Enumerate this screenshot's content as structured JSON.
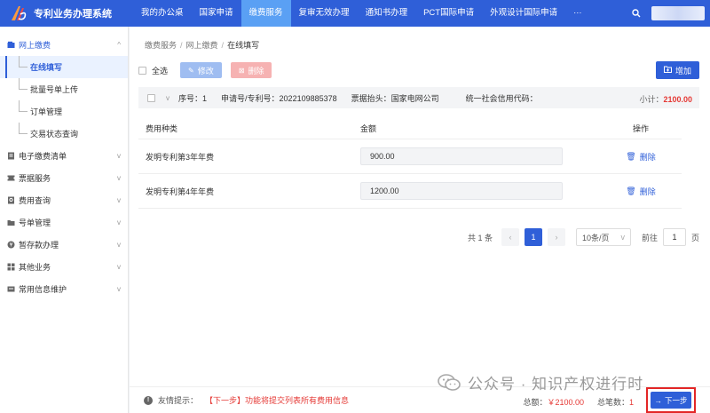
{
  "app": {
    "title": "专利业务办理系统"
  },
  "nav": {
    "items": [
      "我的办公桌",
      "国家申请",
      "缴费服务",
      "复审无效办理",
      "通知书办理",
      "PCT国际申请",
      "外观设计国际申请",
      "···"
    ],
    "active_index": 2
  },
  "sidebar": {
    "groups": [
      {
        "label": "网上缴费",
        "open": true,
        "icon": "wallet-icon"
      },
      {
        "label": "电子缴费清单",
        "icon": "list-icon"
      },
      {
        "label": "票据服务",
        "icon": "ticket-icon"
      },
      {
        "label": "费用查询",
        "icon": "search-doc-icon"
      },
      {
        "label": "号单管理",
        "icon": "folder-icon"
      },
      {
        "label": "暂存款办理",
        "icon": "coin-icon"
      },
      {
        "label": "其他业务",
        "icon": "grid-icon"
      },
      {
        "label": "常用信息维护",
        "icon": "card-icon"
      }
    ],
    "subitems": [
      "在线填写",
      "批量号单上传",
      "订单管理",
      "交易状态查询"
    ],
    "active_sub": 0
  },
  "breadcrumb": [
    "缴费服务",
    "网上缴费",
    "在线填写"
  ],
  "toolbar": {
    "select_all": "全选",
    "edit": "修改",
    "delete": "删除",
    "add": "增加"
  },
  "group_row": {
    "seq_label": "序号：",
    "seq": "1",
    "app_no_label": "申请号/专利号：",
    "app_no": "2022109885378",
    "invoice_label": "票据抬头：",
    "invoice": "国家电网公司",
    "credit_label": "统一社会信用代码：",
    "subtotal_label": "小计：",
    "subtotal": "2100.00"
  },
  "table": {
    "headers": [
      "费用种类",
      "金额",
      "操作"
    ],
    "rows": [
      {
        "fee_type": "发明专利第3年年费",
        "amount": "900.00",
        "action": "删除"
      },
      {
        "fee_type": "发明专利第4年年费",
        "amount": "1200.00",
        "action": "删除"
      }
    ]
  },
  "pager": {
    "total": "共 1 条",
    "current": "1",
    "size": "10条/页",
    "goto_label": "前往",
    "goto_value": "1",
    "page_suffix": "页"
  },
  "footer": {
    "tip_label": "友情提示：",
    "tip_text": "【下一步】功能将提交列表所有费用信息",
    "total_label": "总额：",
    "total_value": "￥2100.00",
    "count_label": "总笔数：",
    "count_value": "1",
    "next": "下一步"
  },
  "watermark": {
    "text": "公众号 · 知识产权进行时"
  },
  "colors": {
    "primary": "#2f5fd8",
    "active_nav": "#5aa0f4",
    "danger": "#e53935"
  }
}
